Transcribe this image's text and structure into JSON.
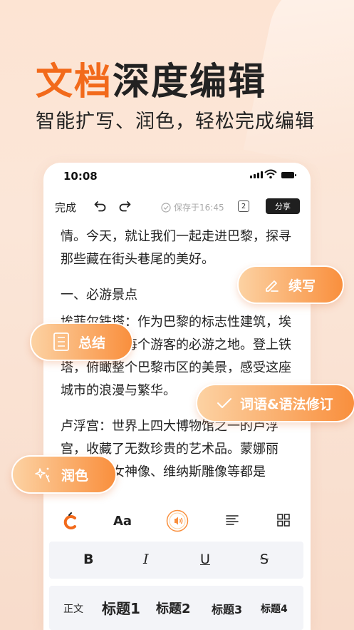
{
  "hero": {
    "title_accent": "文档",
    "title_rest": "深度编辑",
    "subtitle": "智能扩写、润色，轻松完成编辑"
  },
  "status_bar": {
    "time": "10:08"
  },
  "toolbar": {
    "done_label": "完成",
    "saved_label": "保存于16:45",
    "count": "2",
    "share_label": "分享"
  },
  "document": {
    "paragraphs": [
      "情。今天，就让我们一起走进巴黎，探寻那些藏在街头巷尾的美好。",
      "一、必游景点",
      "埃菲尔铁塔：作为巴黎的标志性建筑，埃菲尔铁塔是每个游客的必游之地。登上铁塔，俯瞰整个巴黎市区的美景，感受这座城市的浪漫与繁华。",
      "卢浮宫：世界上四大博物馆之一的卢浮宫，收藏了无数珍贵的艺术品。蒙娜丽莎、胜利女神像、维纳斯雕像等都是"
    ]
  },
  "floating_actions": {
    "continue_label": "续写",
    "summary_label": "总结",
    "grammar_label": "词语&语法修订",
    "polish_label": "润色"
  },
  "format_bar": {
    "font_label": "Aa",
    "bold_label": "B",
    "italic_label": "I",
    "underline_label": "U",
    "strike_label": "S"
  },
  "heading_bar": {
    "body_label": "正文",
    "h1_label": "标题1",
    "h2_label": "标题2",
    "h3_label": "标题3",
    "h4_label": "标题4"
  },
  "colors": {
    "accent": "#f26a1b",
    "pill_start": "#fcd2a3",
    "pill_end": "#f98f3d",
    "share_bg": "#1f1f1f"
  }
}
